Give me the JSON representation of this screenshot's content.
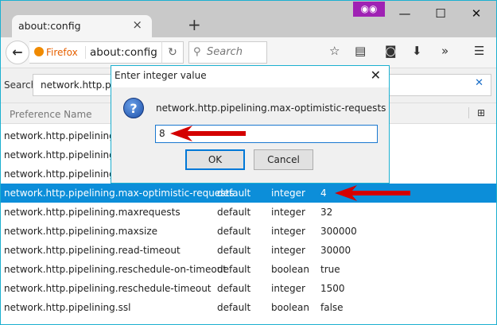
{
  "window": {
    "private_icon": "private-mask-icon",
    "controls": [
      "minimize",
      "maximize",
      "close"
    ]
  },
  "tab": {
    "title": "about:config",
    "close": "×",
    "new_tab": "+"
  },
  "toolbar": {
    "identity": "Firefox",
    "url": "about:config",
    "search_placeholder": "Search"
  },
  "config": {
    "search_label": "Search:",
    "search_value": "network.http.p",
    "column_header": "Preference Name"
  },
  "rows": [
    {
      "name": "network.http.pipelining",
      "status": "",
      "type": "",
      "value": ""
    },
    {
      "name": "network.http.pipelining.a",
      "status": "",
      "type": "",
      "value": ""
    },
    {
      "name": "network.http.pipelining.a",
      "status": "",
      "type": "",
      "value": ""
    },
    {
      "name": "network.http.pipelining.max-optimistic-requests",
      "status": "default",
      "type": "integer",
      "value": "4",
      "selected": true
    },
    {
      "name": "network.http.pipelining.maxrequests",
      "status": "default",
      "type": "integer",
      "value": "32"
    },
    {
      "name": "network.http.pipelining.maxsize",
      "status": "default",
      "type": "integer",
      "value": "300000"
    },
    {
      "name": "network.http.pipelining.read-timeout",
      "status": "default",
      "type": "integer",
      "value": "30000"
    },
    {
      "name": "network.http.pipelining.reschedule-on-timeout",
      "status": "default",
      "type": "boolean",
      "value": "true"
    },
    {
      "name": "network.http.pipelining.reschedule-timeout",
      "status": "default",
      "type": "integer",
      "value": "1500"
    },
    {
      "name": "network.http.pipelining.ssl",
      "status": "default",
      "type": "boolean",
      "value": "false"
    }
  ],
  "dialog": {
    "title": "Enter integer value",
    "message": "network.http.pipelining.max-optimistic-requests",
    "value": "8",
    "ok": "OK",
    "cancel": "Cancel"
  },
  "colors": {
    "selection": "#0c8ed9",
    "arrow": "#d40000",
    "private": "#9f22b4"
  }
}
